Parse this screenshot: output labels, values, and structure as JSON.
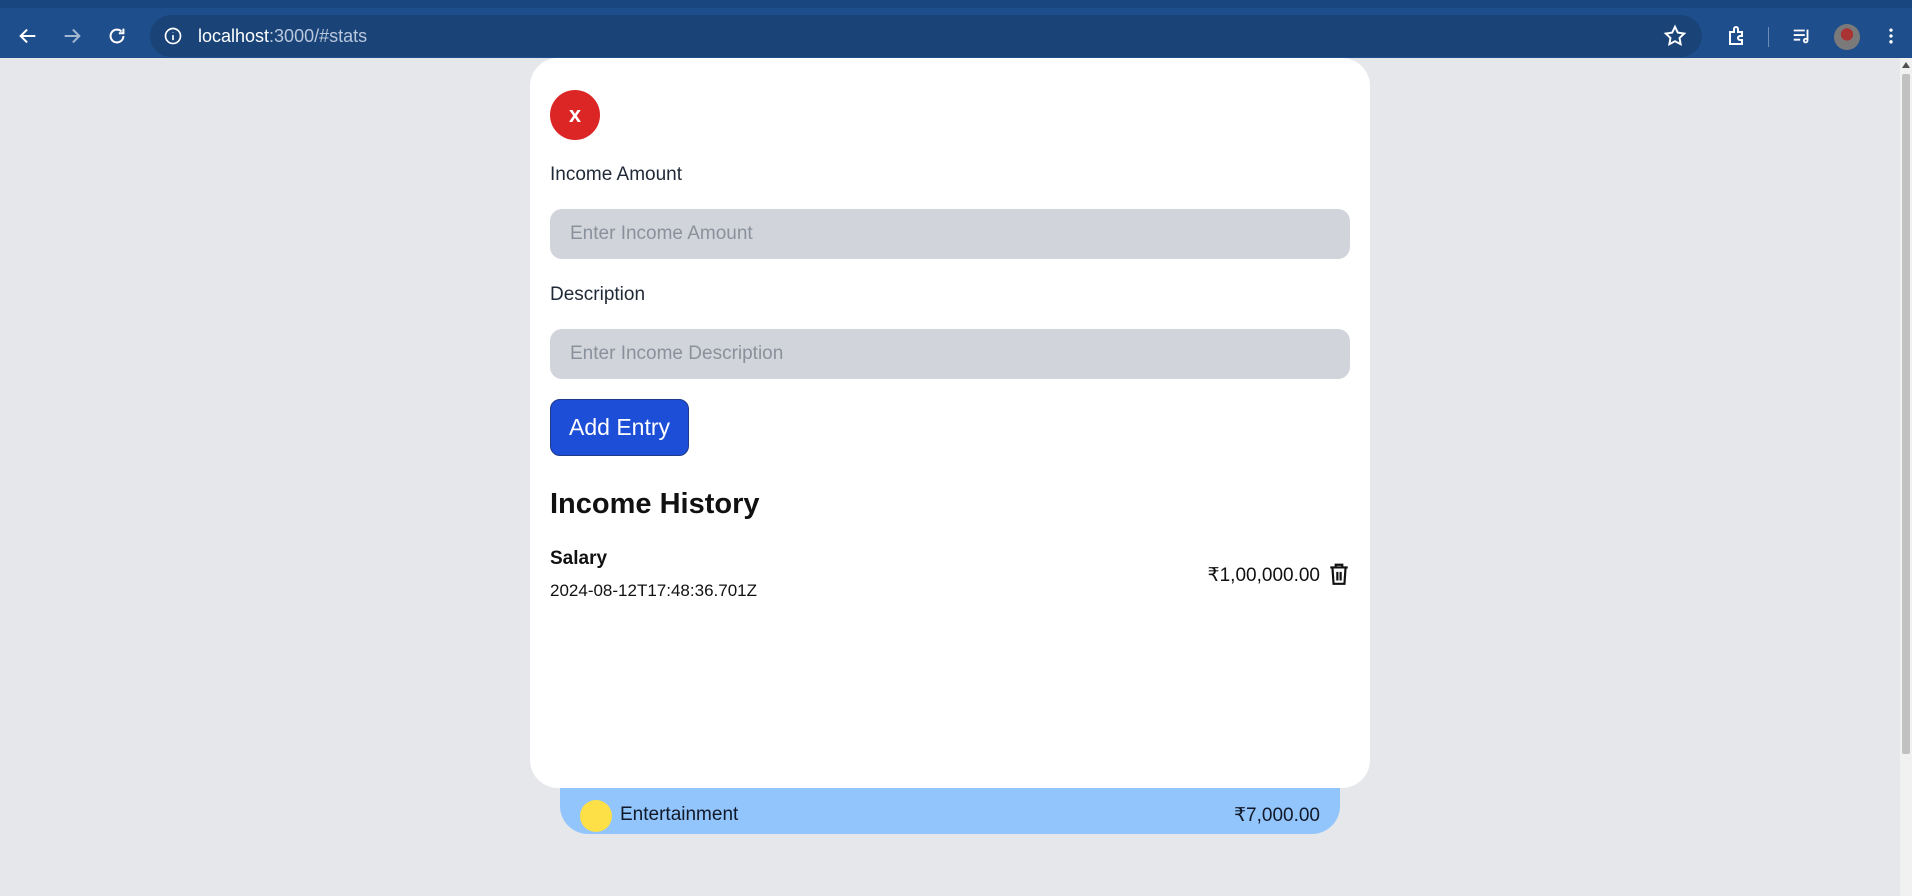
{
  "browser": {
    "url_host": "localhost",
    "url_path": ":3000/#stats",
    "icons": [
      "back-icon",
      "forward-icon",
      "reload-icon",
      "info-icon",
      "star-icon",
      "extensions-icon",
      "media-icon",
      "profile-avatar",
      "menu-icon"
    ]
  },
  "modal": {
    "close_label": "x",
    "income_amount_label": "Income Amount",
    "income_amount_placeholder": "Enter Income Amount",
    "income_amount_value": "",
    "description_label": "Description",
    "description_placeholder": "Enter Income Description",
    "description_value": "",
    "add_button_label": "Add Entry",
    "history_title": "Income History",
    "entries": [
      {
        "description": "Salary",
        "date": "2024-08-12T17:48:36.701Z",
        "amount": "₹1,00,000.00"
      }
    ]
  },
  "background_card": {
    "category": "Entertainment",
    "amount": "₹7,000.00",
    "dot_color": "#fde047",
    "card_color": "#93c5fd"
  },
  "colors": {
    "close_button": "#dc2626",
    "primary_button": "#1d4ed8",
    "chrome": "#1f4e8c"
  }
}
